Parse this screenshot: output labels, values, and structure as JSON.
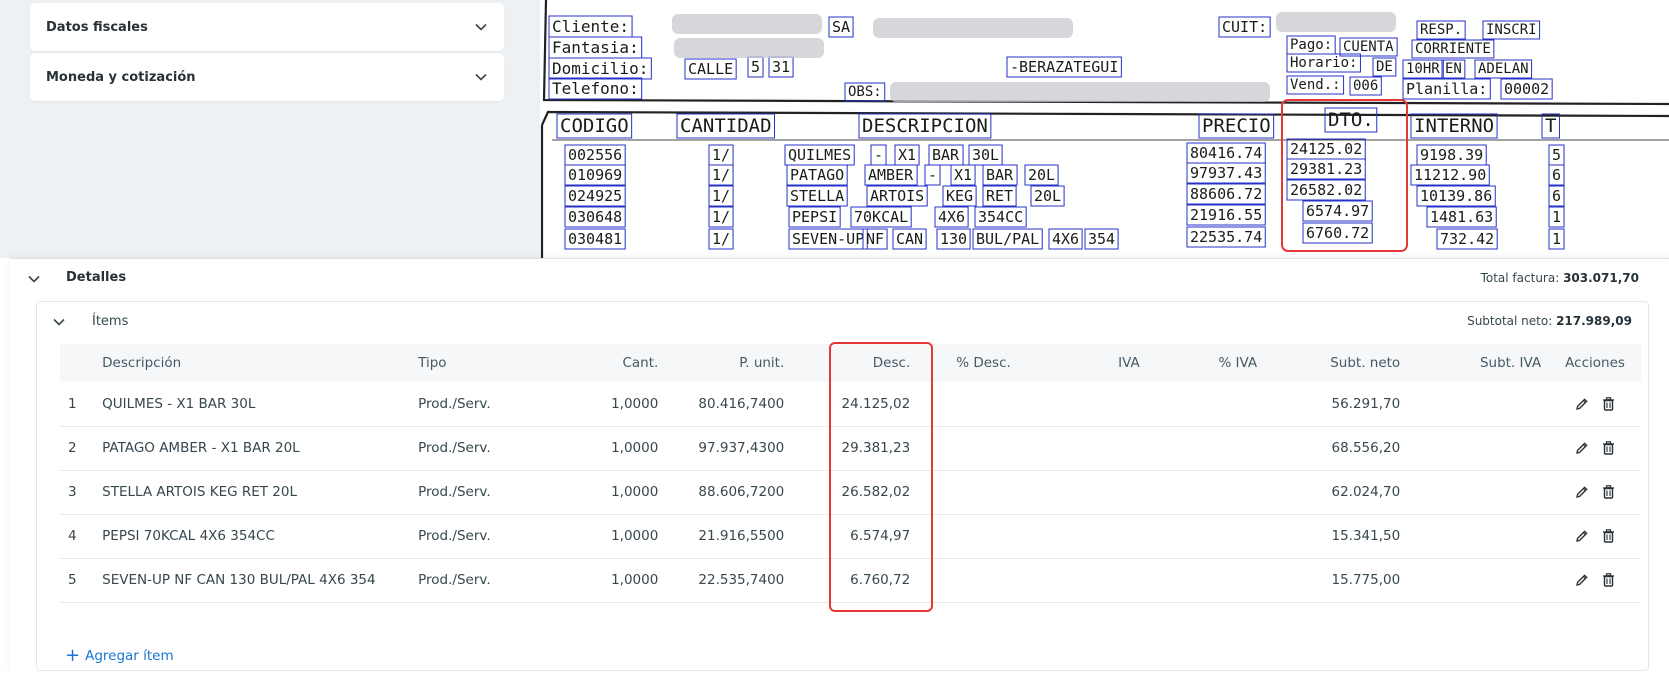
{
  "left_panel": {
    "sections": [
      {
        "title": "Datos fiscales"
      },
      {
        "title": "Moneda y cotización"
      }
    ]
  },
  "document": {
    "header": {
      "cliente_label": "Cliente:",
      "cliente_value": "SA",
      "cuit_label": "CUIT:",
      "resp_label": "RESP.",
      "inscri_label": "INSCRI",
      "fantasia_label": "Fantasia:",
      "pago_label": "Pago:",
      "pago_value1": "CUENTA",
      "pago_value2": "CORRIENTE",
      "domicilio_label": "Domicilio:",
      "calle": "CALLE",
      "calle_num": "5",
      "calle_num2": "31",
      "localidad": "-BERAZATEGUI",
      "horario_label": "Horario:",
      "horario_de": "DE",
      "horario_10hr": "10HR",
      "horario_en": "EN",
      "horario_adelan": "ADELAN",
      "telefono_label": "Telefono:",
      "obs_label": "OBS:",
      "vend_label": "Vend.:",
      "vend_value": "006",
      "planilla_label": "Planilla:",
      "planilla_value": "00002"
    },
    "columns": [
      "CODIGO",
      "CANTIDAD",
      "DESCRIPCION",
      "PRECIO",
      "DTO.",
      "INTERNO",
      "T"
    ],
    "rows": [
      {
        "codigo": "002556",
        "cantidad": "1/",
        "desc": [
          "QUILMES",
          "-",
          "X1",
          "BAR",
          "30L"
        ],
        "precio": "80416.74",
        "dto": "24125.02",
        "interno": "9198.39",
        "t": "5"
      },
      {
        "codigo": "010969",
        "cantidad": "1/",
        "desc": [
          "PATAGO",
          "AMBER",
          "-",
          "X1",
          "BAR",
          "20L"
        ],
        "precio": "97937.43",
        "dto": "29381.23",
        "interno": "11212.90",
        "t": "6"
      },
      {
        "codigo": "024925",
        "cantidad": "1/",
        "desc": [
          "STELLA",
          "ARTOIS",
          "KEG",
          "RET",
          "20L"
        ],
        "precio": "88606.72",
        "dto": "26582.02",
        "interno": "10139.86",
        "t": "6"
      },
      {
        "codigo": "030648",
        "cantidad": "1/",
        "desc": [
          "PEPSI",
          "70KCAL",
          "4X6",
          "354CC"
        ],
        "precio": "21916.55",
        "dto": "6574.97",
        "interno": "1481.63",
        "t": "1"
      },
      {
        "codigo": "030481",
        "cantidad": "1/",
        "desc": [
          "SEVEN-UP",
          "NF",
          "CAN",
          "130",
          "BUL/PAL",
          "4X6",
          "354"
        ],
        "precio": "22535.74",
        "dto": "6760.72",
        "interno": "732.42",
        "t": "1"
      }
    ],
    "colors": {
      "ocr_box": "#2430c8",
      "highlight": "#e53935",
      "ink": "#222222"
    }
  },
  "details": {
    "title": "Detalles",
    "total_label": "Total factura:",
    "total_value": "303.071,70",
    "items": {
      "title": "Ítems",
      "subtotal_label": "Subtotal neto:",
      "subtotal_value": "217.989,09",
      "columns": [
        "Descripción",
        "Tipo",
        "Cant.",
        "P. unit.",
        "Desc.",
        "% Desc.",
        "IVA",
        "% IVA",
        "Subt. neto",
        "Subt. IVA",
        "Acciones"
      ],
      "rows": [
        {
          "n": "1",
          "descripcion": "QUILMES - X1 BAR 30L",
          "tipo": "Prod./Serv.",
          "cant": "1,0000",
          "punit": "80.416,7400",
          "desc": "24.125,02",
          "pdesc": "",
          "iva": "",
          "piva": "",
          "subt_neto": "56.291,70",
          "subt_iva": ""
        },
        {
          "n": "2",
          "descripcion": "PATAGO AMBER - X1 BAR 20L",
          "tipo": "Prod./Serv.",
          "cant": "1,0000",
          "punit": "97.937,4300",
          "desc": "29.381,23",
          "pdesc": "",
          "iva": "",
          "piva": "",
          "subt_neto": "68.556,20",
          "subt_iva": ""
        },
        {
          "n": "3",
          "descripcion": "STELLA ARTOIS KEG RET 20L",
          "tipo": "Prod./Serv.",
          "cant": "1,0000",
          "punit": "88.606,7200",
          "desc": "26.582,02",
          "pdesc": "",
          "iva": "",
          "piva": "",
          "subt_neto": "62.024,70",
          "subt_iva": ""
        },
        {
          "n": "4",
          "descripcion": "PEPSI 70KCAL 4X6 354CC",
          "tipo": "Prod./Serv.",
          "cant": "1,0000",
          "punit": "21.916,5500",
          "desc": "6.574,97",
          "pdesc": "",
          "iva": "",
          "piva": "",
          "subt_neto": "15.341,50",
          "subt_iva": ""
        },
        {
          "n": "5",
          "descripcion": "SEVEN-UP NF CAN 130 BUL/PAL 4X6 354",
          "tipo": "Prod./Serv.",
          "cant": "1,0000",
          "punit": "22.535,7400",
          "desc": "6.760,72",
          "pdesc": "",
          "iva": "",
          "piva": "",
          "subt_neto": "15.775,00",
          "subt_iva": ""
        }
      ],
      "add_label": "Agregar ítem"
    }
  },
  "icons": {
    "chevron": "chevron-down-icon",
    "edit": "pencil-icon",
    "delete": "trash-icon",
    "add": "plus-icon"
  },
  "colors": {
    "accent": "#1976d2",
    "highlight": "#e53935",
    "panel_bg": "#eef1f4"
  }
}
